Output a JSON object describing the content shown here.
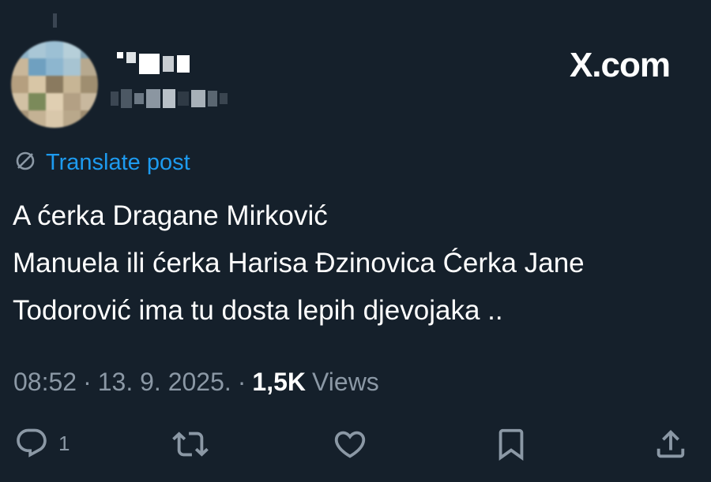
{
  "header": {
    "brand": "X.com"
  },
  "translate": {
    "label": "Translate post"
  },
  "post": {
    "lines": [
      "A ćerka Dragane Mirković",
      "Manuela ili ćerka Harisa Đzinovica Ćerka Jane",
      "Todorović ima tu dosta lepih djevojaka .."
    ]
  },
  "meta": {
    "time": "08:52",
    "sep1": "·",
    "date": "13. 9. 2025.",
    "sep2": "·",
    "views_count": "1,5K",
    "views_label": "Views"
  },
  "actions": {
    "reply_count": "1",
    "icons": [
      "reply-icon",
      "repost-icon",
      "like-icon",
      "bookmark-icon",
      "share-icon"
    ]
  },
  "colors": {
    "background": "#15202b",
    "accent": "#1d9bf0",
    "muted": "#8b98a5",
    "text": "#ffffff"
  }
}
